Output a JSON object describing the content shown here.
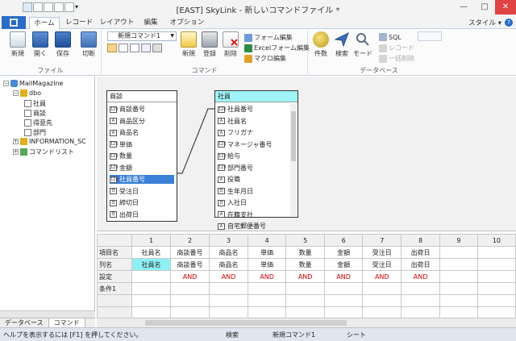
{
  "window": {
    "title": "[EAST] SkyLink - 新しいコマンドファイル *",
    "minimize": "—",
    "maximize": "□",
    "close": "✕"
  },
  "tabs": [
    "ホーム",
    "レコード",
    "レイアウト",
    "編集",
    "オプション"
  ],
  "style_menu": "スタイル ▾",
  "ribbon": {
    "file_group": {
      "label": "ファイル",
      "buttons": [
        "新規",
        "開く",
        "保存",
        "切断"
      ]
    },
    "command_group": {
      "label": "コマンド",
      "combo_value": "新規コマンド1",
      "buttons": [
        "新規",
        "登録",
        "削除"
      ],
      "small_buttons": [
        "フォーム編集",
        "Excelフォーム編集",
        "マクロ編集"
      ]
    },
    "database_group": {
      "label": "データベース",
      "buttons": [
        "件数",
        "検索",
        "モード"
      ],
      "small_buttons": [
        "SQL",
        "レコード",
        "一括削除"
      ]
    }
  },
  "tree": {
    "root": "MailMagazine",
    "schema": "dbo",
    "tables": [
      "社員",
      "商談",
      "得意先",
      "部門"
    ],
    "info_schema": "INFORMATION_SC",
    "command_list": "コマンドリスト",
    "bottom_tabs": [
      "データベース",
      "コマンド"
    ]
  },
  "tables": {
    "left": {
      "name": "商談",
      "fields": [
        {
          "label": "商談番号",
          "type": "123"
        },
        {
          "label": "商品区分",
          "type": "A"
        },
        {
          "label": "商品名",
          "type": "A"
        },
        {
          "label": "単価",
          "type": "123"
        },
        {
          "label": "数量",
          "type": "123"
        },
        {
          "label": "金額",
          "type": "123"
        },
        {
          "label": "社員番号",
          "type": "123"
        },
        {
          "label": "受注日",
          "type": "D"
        },
        {
          "label": "締切日",
          "type": "D"
        },
        {
          "label": "出荷日",
          "type": "D"
        }
      ]
    },
    "right": {
      "name": "社員",
      "fields": [
        {
          "label": "社員番号",
          "type": "123"
        },
        {
          "label": "社員名",
          "type": "A"
        },
        {
          "label": "フリガナ",
          "type": "A"
        },
        {
          "label": "マネージャ番号",
          "type": "123"
        },
        {
          "label": "給与",
          "type": "123"
        },
        {
          "label": "部門番号",
          "type": "123"
        },
        {
          "label": "役職",
          "type": "A"
        },
        {
          "label": "生年月日",
          "type": "D"
        },
        {
          "label": "入社日",
          "type": "D"
        },
        {
          "label": "在籍支社",
          "type": "A"
        },
        {
          "label": "自宅郵便番号",
          "type": "A"
        }
      ]
    }
  },
  "grid": {
    "columns": [
      "1",
      "2",
      "3",
      "4",
      "5",
      "6",
      "7",
      "8",
      "9",
      "10"
    ],
    "rows": [
      {
        "label": "項目名",
        "cells": [
          "社員名",
          "商談番号",
          "商品名",
          "単価",
          "数量",
          "金額",
          "受注日",
          "出荷日",
          "",
          ""
        ]
      },
      {
        "label": "列名",
        "cells": [
          "社員名",
          "商談番号",
          "商品名",
          "単価",
          "数量",
          "金額",
          "受注日",
          "出荷日",
          "",
          ""
        ]
      },
      {
        "label": "設定",
        "cells": [
          "",
          "AND",
          "AND",
          "AND",
          "AND",
          "AND",
          "AND",
          "AND",
          "",
          ""
        ]
      },
      {
        "label": "条件1",
        "cells": [
          "",
          "",
          "",
          "",
          "",
          "",
          "",
          "",
          "",
          ""
        ]
      }
    ]
  },
  "status": {
    "help": "ヘルプを表示するには [F1] を押してください。",
    "mode": "検索",
    "command": "新規コマンド1",
    "sheet": "シート"
  },
  "colors": {
    "accent": "#2b6cc4",
    "selected_field": "#3a80d6",
    "table_header_highlight": "#9ef4f6",
    "and_text": "#d00000"
  }
}
